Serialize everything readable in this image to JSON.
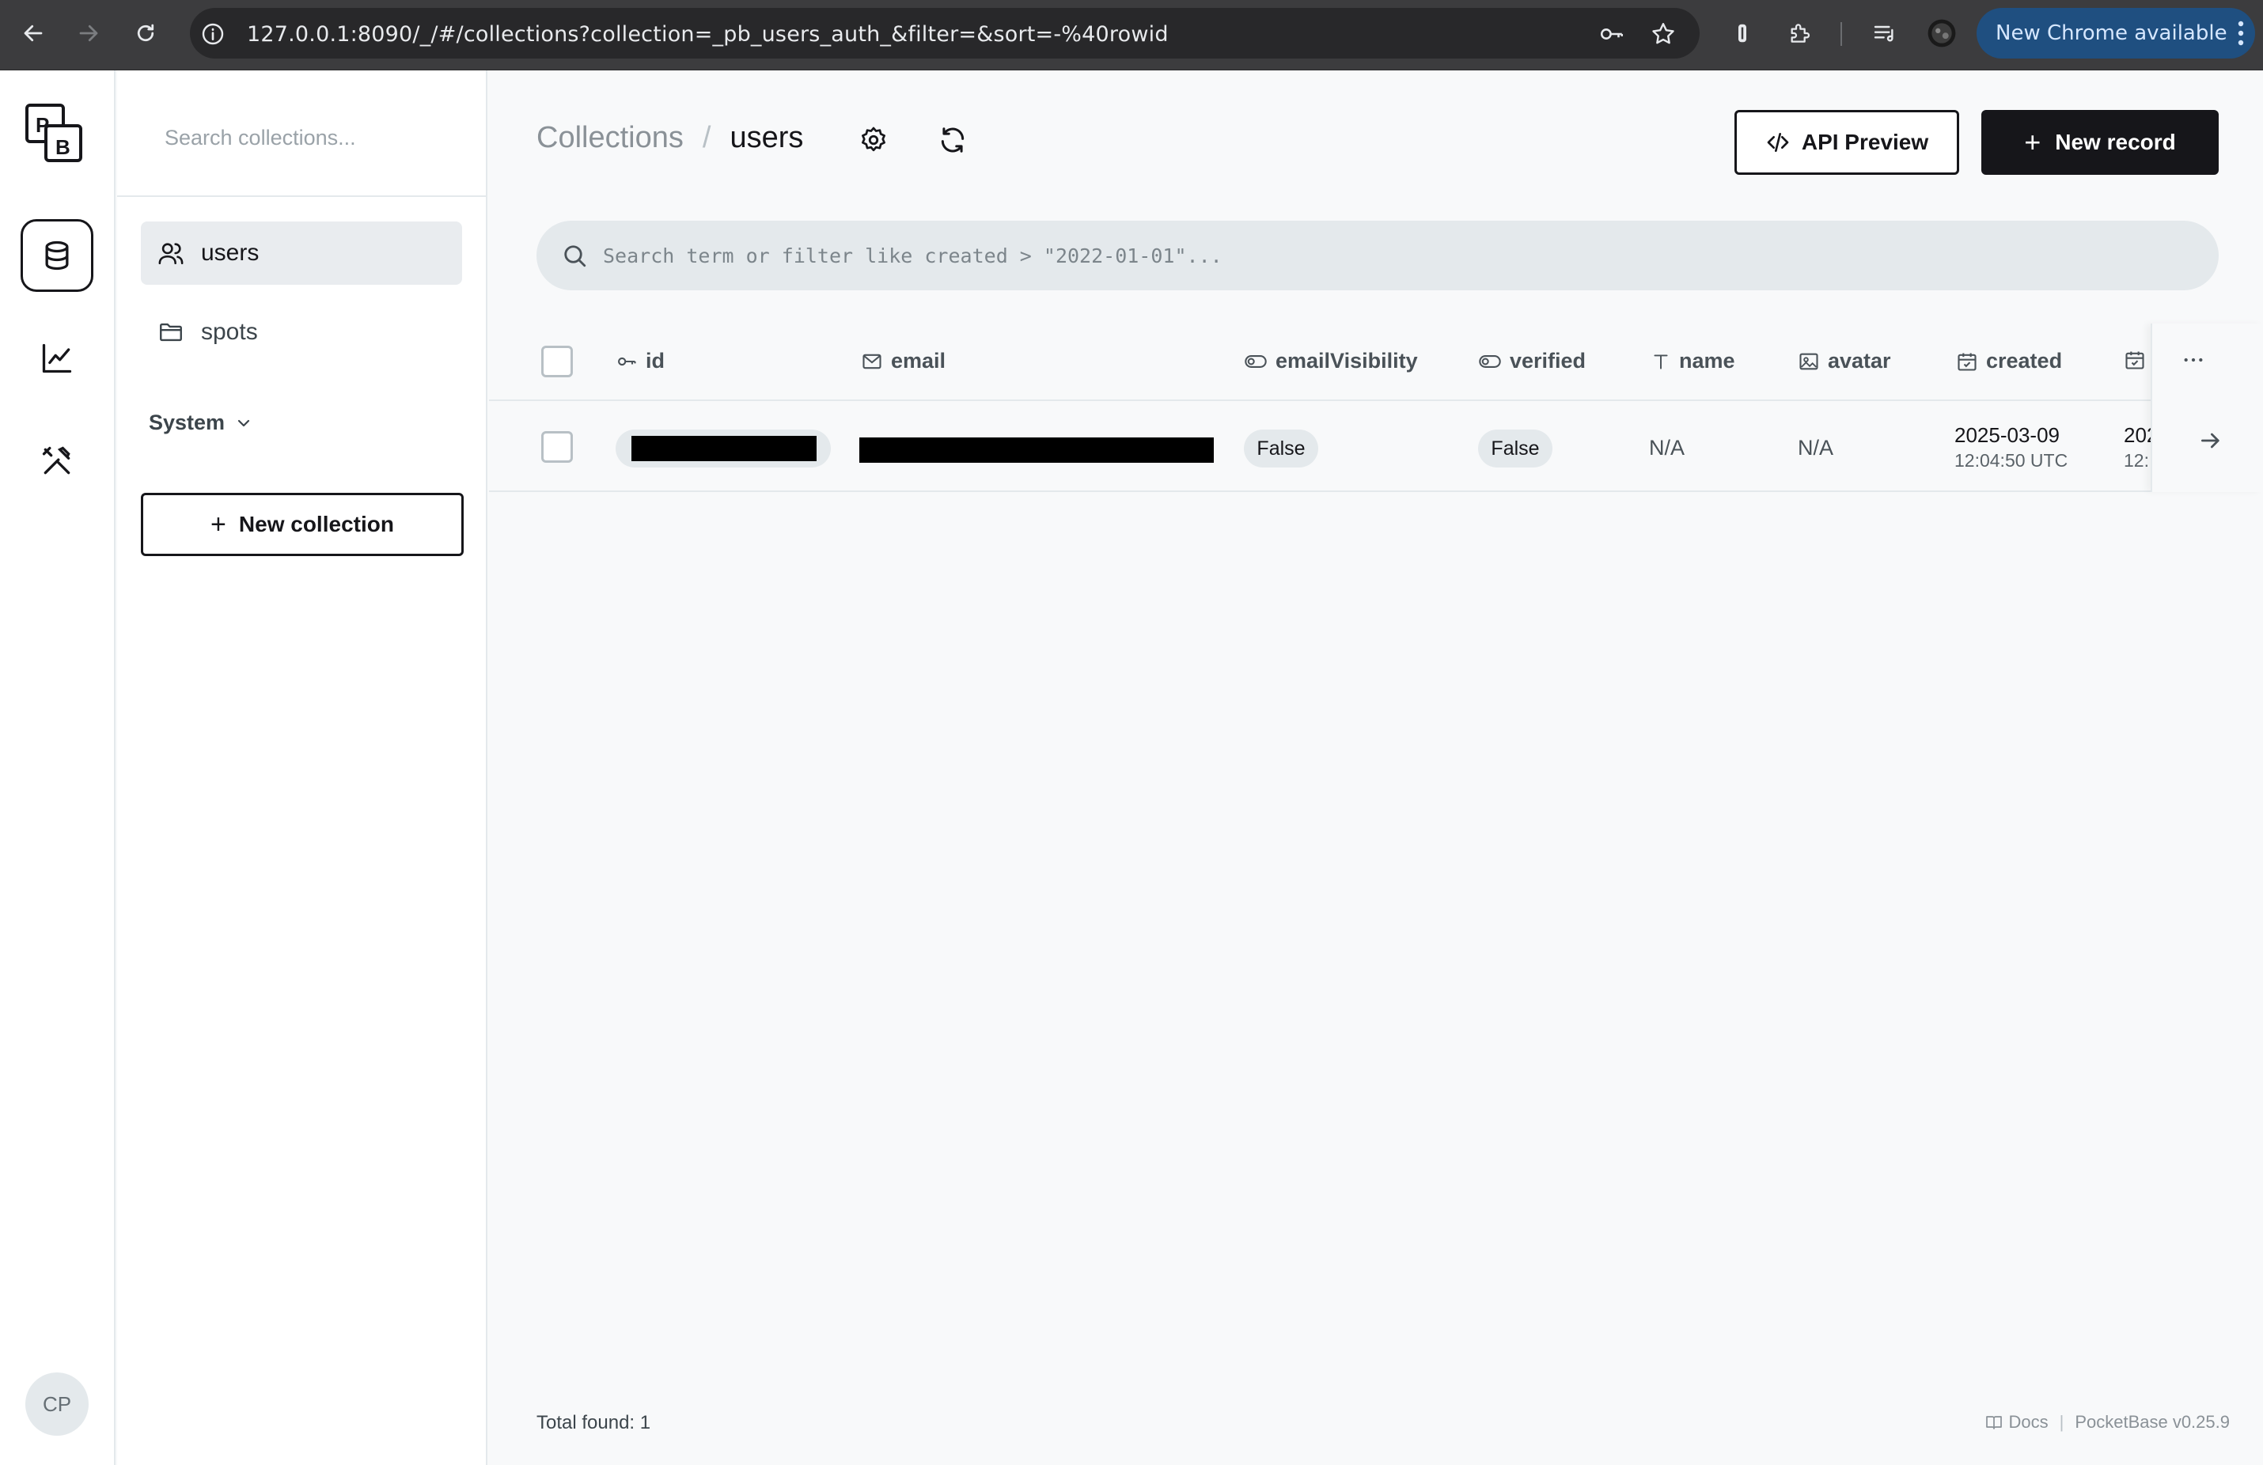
{
  "browser": {
    "url": "127.0.0.1:8090/_/#/collections?collection=_pb_users_auth_&filter=&sort=-%40rowid",
    "update_label": "New Chrome available"
  },
  "sidebar": {
    "search_placeholder": "Search collections...",
    "items": [
      {
        "label": "users",
        "icon": "users-icon"
      },
      {
        "label": "spots",
        "icon": "folder-icon"
      }
    ],
    "system_label": "System",
    "new_collection_label": "New collection"
  },
  "header": {
    "breadcrumb_root": "Collections",
    "breadcrumb_current": "users",
    "api_preview_label": "API Preview",
    "new_record_label": "New record"
  },
  "search": {
    "placeholder": "Search term or filter like created > \"2022-01-01\"..."
  },
  "table": {
    "columns": [
      {
        "label": "id",
        "icon": "key-icon"
      },
      {
        "label": "email",
        "icon": "mail-icon"
      },
      {
        "label": "emailVisibility",
        "icon": "toggle-icon"
      },
      {
        "label": "verified",
        "icon": "toggle-icon"
      },
      {
        "label": "name",
        "icon": "text-icon"
      },
      {
        "label": "avatar",
        "icon": "image-icon"
      },
      {
        "label": "created",
        "icon": "calendar-icon"
      },
      {
        "label": "",
        "icon": "calendar-icon"
      }
    ],
    "rows": [
      {
        "email_visibility": "False",
        "verified": "False",
        "name": "N/A",
        "avatar": "N/A",
        "created_date": "2025-03-09",
        "created_time": "12:04:50 UTC",
        "updated_date_partial": "202",
        "updated_time_partial": "12:"
      }
    ]
  },
  "footer": {
    "total_label": "Total found:",
    "total_count": "1",
    "docs_label": "Docs",
    "version": "PocketBase v0.25.9"
  },
  "user": {
    "initials": "CP"
  },
  "colors": {
    "accent_dark": "#16161a",
    "update_pill": "#1f4f80"
  }
}
